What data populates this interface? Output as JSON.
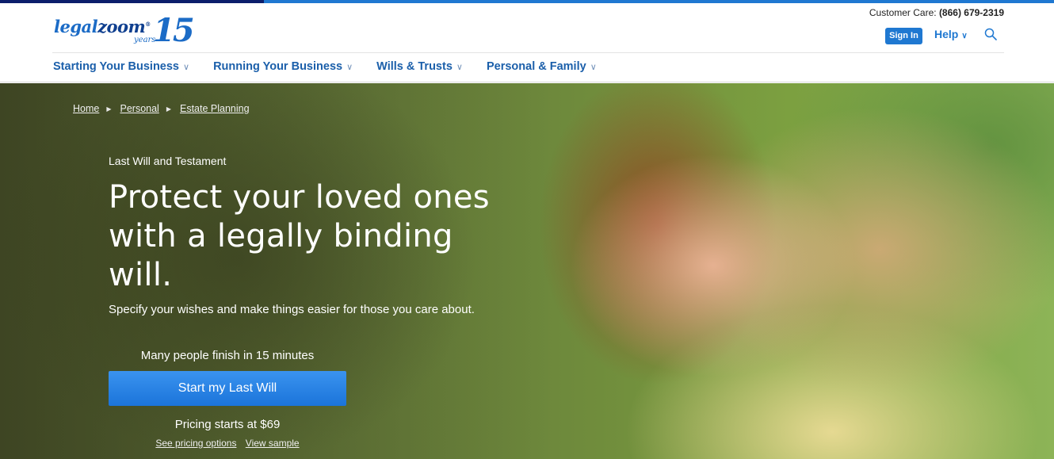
{
  "brand": {
    "logo_legal": "legal",
    "logo_zoom": "zoom",
    "logo_years": "years",
    "logo_number": "15"
  },
  "header": {
    "customer_care_label": "Customer Care:",
    "customer_care_phone": "(866) 679-2319",
    "sign_in": "Sign In",
    "help": "Help",
    "search_icon": "search-icon"
  },
  "nav": {
    "items": [
      {
        "label": "Starting Your Business"
      },
      {
        "label": "Running Your Business"
      },
      {
        "label": "Wills & Trusts"
      },
      {
        "label": "Personal & Family"
      }
    ]
  },
  "breadcrumb": [
    "Home",
    "Personal",
    "Estate Planning"
  ],
  "hero": {
    "eyebrow": "Last Will and Testament",
    "headline": "Protect your loved ones with a legally binding will.",
    "subhead": "Specify your wishes and make things easier for those you care about.",
    "finish_note": "Many people finish in 15 minutes",
    "cta": "Start my Last Will",
    "pricing": "Pricing starts at $69",
    "link_pricing": "See pricing options",
    "link_sample": "View sample"
  },
  "colors": {
    "brand_blue": "#1f78d1",
    "nav_blue": "#1b5faa",
    "top_strip_dark": "#0c1e6b"
  }
}
